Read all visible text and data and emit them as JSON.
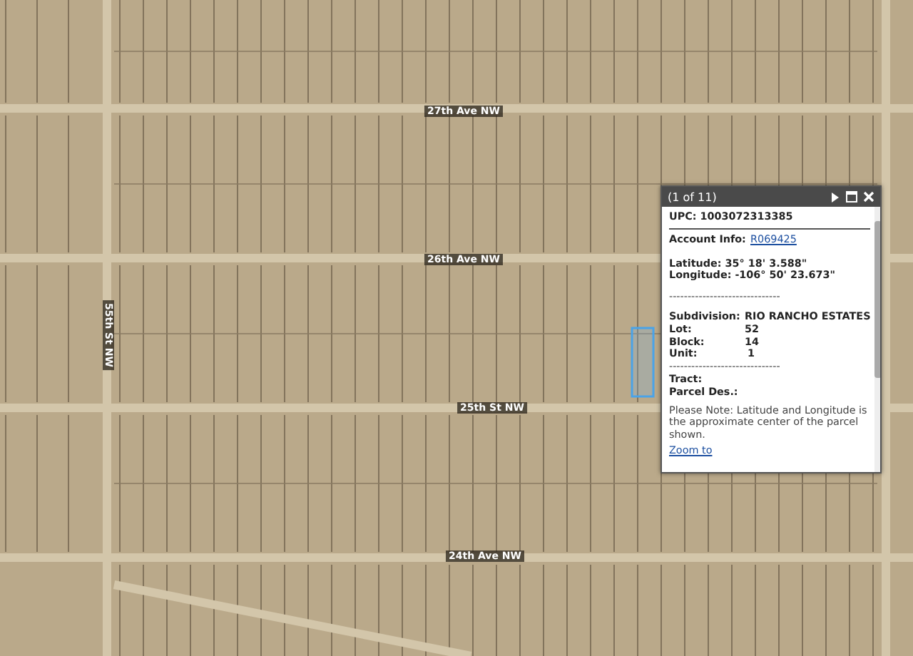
{
  "map": {
    "street_labels": [
      {
        "text": "27th Ave NW",
        "kind": "horizontal"
      },
      {
        "text": "26th Ave NW",
        "kind": "horizontal"
      },
      {
        "text": "25th St NW",
        "kind": "horizontal"
      },
      {
        "text": "24th Ave NW",
        "kind": "horizontal"
      },
      {
        "text": "55th St NW",
        "kind": "vertical"
      }
    ],
    "highlighted_parcel": true
  },
  "popup": {
    "title": "(1 of 11)",
    "upc": "UPC: 1003072313385",
    "account_label": "Account Info:",
    "account_link": "R069425",
    "latitude": "Latitude: 35° 18' 3.588\"",
    "longitude": "Longitude: -106° 50' 23.673\"",
    "divider_1": "------------------------------",
    "fields": [
      {
        "label": "Subdivision:",
        "value": "RIO RANCHO ESTATES"
      },
      {
        "label": "Lot:",
        "value": "52"
      },
      {
        "label": "Block:",
        "value": "14"
      },
      {
        "label": "Unit:",
        "value": "1"
      }
    ],
    "divider_2": "------------------------------",
    "tract": "Tract:",
    "parcel_des": "Parcel Des.:",
    "note": "Please Note: Latitude and Longitude is the approximate center of the parcel shown.",
    "zoom_link": "Zoom to"
  }
}
